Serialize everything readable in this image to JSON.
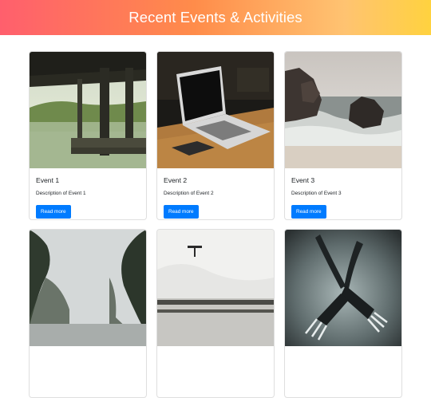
{
  "header": {
    "title": "Recent Events & Activities"
  },
  "read_more_label": "Read more",
  "events": [
    {
      "title": "Event 1",
      "description": "Description of Event 1",
      "image": "pier-lake-photo"
    },
    {
      "title": "Event 2",
      "description": "Description of Event 2",
      "image": "laptop-desk-photo"
    },
    {
      "title": "Event 3",
      "description": "Description of Event 3",
      "image": "beach-rocks-photo"
    },
    {
      "title": "",
      "description": "",
      "image": "foggy-trees-road-photo"
    },
    {
      "title": "",
      "description": "",
      "image": "snow-bench-photo"
    },
    {
      "title": "",
      "description": "",
      "image": "forks-closeup-photo"
    }
  ],
  "colors": {
    "primary_button": "#007bff",
    "header_gradient_start": "#ff5f6d",
    "header_gradient_end": "#ffd23f"
  }
}
